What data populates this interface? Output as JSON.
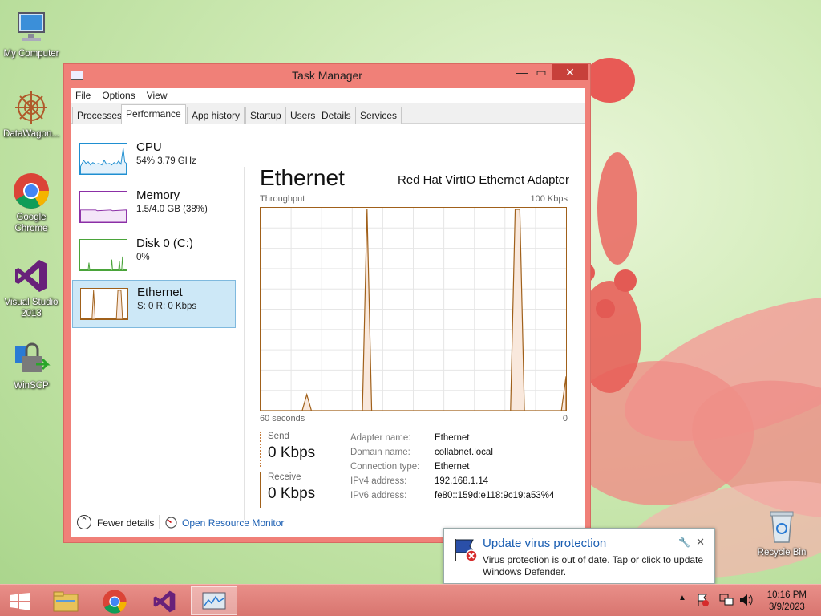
{
  "desktop": {
    "icons": [
      {
        "label": "My Computer"
      },
      {
        "label": "DataWagon..."
      },
      {
        "label": "Google Chrome"
      },
      {
        "label": "Visual Studio 2013"
      },
      {
        "label": "WinSCP"
      },
      {
        "label": "Recycle Bin"
      }
    ]
  },
  "window": {
    "title": "Task Manager",
    "controls": {
      "minimize": "—",
      "maximize": "▭",
      "close": "✕"
    }
  },
  "menu": [
    "File",
    "Options",
    "View"
  ],
  "tabs": [
    "Processes",
    "Performance",
    "App history",
    "Startup",
    "Users",
    "Details",
    "Services"
  ],
  "active_tab": "Performance",
  "sidebar": {
    "items": [
      {
        "label": "CPU",
        "sub": "54%  3.79 GHz",
        "color": "#1f8fd1"
      },
      {
        "label": "Memory",
        "sub": "1.5/4.0 GB (38%)",
        "color": "#8b2fa6"
      },
      {
        "label": "Disk 0 (C:)",
        "sub": "0%",
        "color": "#4aa43a"
      },
      {
        "label": "Ethernet",
        "sub": "S: 0 R: 0 Kbps",
        "color": "#a0601a"
      }
    ]
  },
  "detail": {
    "title": "Ethernet",
    "adapter": "Red Hat VirtIO Ethernet Adapter",
    "graph_label": "Throughput",
    "graph_max": "100 Kbps",
    "time_left": "60 seconds",
    "time_right": "0",
    "send_label": "Send",
    "send_value": "0 Kbps",
    "receive_label": "Receive",
    "receive_value": "0 Kbps",
    "info": [
      {
        "key": "Adapter name:",
        "value": "Ethernet"
      },
      {
        "key": "Domain name:",
        "value": "collabnet.local"
      },
      {
        "key": "Connection type:",
        "value": "Ethernet"
      },
      {
        "key": "IPv4 address:",
        "value": "192.168.1.14"
      },
      {
        "key": "IPv6 address:",
        "value": "fe80::159d:e118:9c19:a53%4"
      }
    ]
  },
  "footer": {
    "fewer_details": "Fewer details",
    "resource_monitor": "Open Resource Monitor"
  },
  "notification": {
    "title": "Update virus protection",
    "body": "Virus protection is out of date. Tap or click to update Windows Defender."
  },
  "taskbar": {
    "time": "10:16 PM",
    "date": "3/9/2023"
  },
  "chart_data": {
    "type": "area",
    "xlabel": "",
    "ylabel": "Throughput",
    "xlim": [
      60,
      0
    ],
    "ylim": [
      0,
      100
    ],
    "series": [
      {
        "values": [
          0,
          0,
          0,
          0,
          0,
          0,
          0,
          0,
          0,
          0,
          8,
          0,
          0,
          0,
          0,
          0,
          0,
          0,
          0,
          0,
          0,
          0,
          0,
          100,
          0,
          0,
          0,
          0,
          0,
          0,
          0,
          0,
          0,
          0,
          0,
          0,
          0,
          0,
          0,
          0,
          0,
          0,
          0,
          0,
          0,
          0,
          0,
          0,
          0,
          0,
          0,
          0,
          0,
          0,
          0,
          100,
          100,
          0,
          0,
          0,
          0,
          0,
          0,
          0,
          0,
          0,
          17
        ]
      }
    ],
    "colors": {
      "line": "#a0601a",
      "fill": "#f9e8dc",
      "grid": "#e6e6e6"
    }
  }
}
